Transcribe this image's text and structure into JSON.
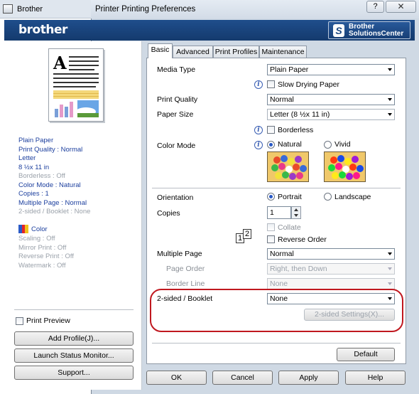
{
  "window": {
    "outer_title": "Brother",
    "dialog_title": "Printer Printing Preferences",
    "help_glyph": "?",
    "close_glyph": "✕"
  },
  "banner": {
    "brand": "brother",
    "solutions_line1": "Brother",
    "solutions_line2": "SolutionsCenter",
    "color": "#1f4e8c"
  },
  "summary": {
    "lines": [
      "Plain Paper",
      "Print Quality : Normal",
      "Letter",
      "8 ½x 11 in"
    ],
    "borderless": "Borderless : Off",
    "color_mode": "Color Mode : Natural",
    "copies": "Copies : 1",
    "multiple_page": "Multiple Page : Normal",
    "two_sided": "2-sided / Booklet : None",
    "color_label": "Color",
    "scaling": "Scaling : Off",
    "mirror": "Mirror Print : Off",
    "reverse": "Reverse Print : Off",
    "watermark": "Watermark : Off"
  },
  "left_actions": {
    "print_preview": "Print Preview",
    "add_profile": "Add Profile(J)...",
    "launch_status": "Launch Status Monitor...",
    "support": "Support..."
  },
  "tabs": [
    "Basic",
    "Advanced",
    "Print Profiles",
    "Maintenance"
  ],
  "basic": {
    "media_type_label": "Media Type",
    "media_type_value": "Plain Paper",
    "slow_drying": "Slow Drying Paper",
    "print_quality_label": "Print Quality",
    "print_quality_value": "Normal",
    "paper_size_label": "Paper Size",
    "paper_size_value": "Letter (8 ½x 11 in)",
    "borderless": "Borderless",
    "color_mode_label": "Color Mode",
    "natural": "Natural",
    "vivid": "Vivid",
    "orientation_label": "Orientation",
    "portrait": "Portrait",
    "landscape": "Landscape",
    "copies_label": "Copies",
    "copies_value": "1",
    "collate": "Collate",
    "reverse_order": "Reverse Order",
    "multiple_page_label": "Multiple Page",
    "multiple_page_value": "Normal",
    "page_order_label": "Page Order",
    "page_order_value": "Right, then Down",
    "border_line_label": "Border Line",
    "border_line_value": "None",
    "two_sided_label": "2-sided / Booklet",
    "two_sided_value": "None",
    "two_sided_settings": "2-sided Settings(X)...",
    "default_btn": "Default",
    "info_glyph": "i",
    "copies_glyph": "12"
  },
  "footer": {
    "ok": "OK",
    "cancel": "Cancel",
    "apply": "Apply",
    "help": "Help"
  }
}
